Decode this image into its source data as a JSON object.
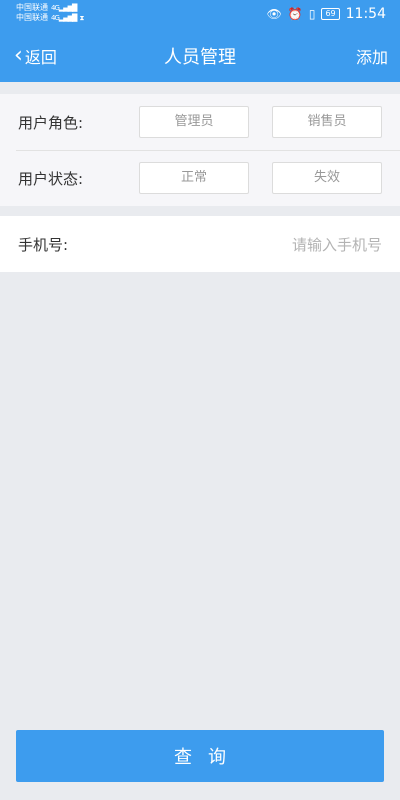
{
  "status_bar": {
    "carrier_1": "中国联通",
    "carrier_2": "中国联通",
    "signal_1": "4G",
    "signal_2": "4G",
    "battery": "69",
    "time": "11:54",
    "icons": [
      "eye-icon",
      "alarm-icon",
      "vibrate-icon",
      "battery-icon"
    ]
  },
  "nav": {
    "back_label": "返回",
    "title": "人员管理",
    "add_label": "添加"
  },
  "filters": {
    "role_label": "用户角色:",
    "role_options": [
      "管理员",
      "销售员"
    ],
    "status_label": "用户状态:",
    "status_options": [
      "正常",
      "失效"
    ]
  },
  "phone": {
    "label": "手机号:",
    "placeholder": "请输入手机号",
    "value": ""
  },
  "actions": {
    "query_label": "查询"
  },
  "colors": {
    "primary": "#3d9cee",
    "background": "#e9ebef"
  }
}
